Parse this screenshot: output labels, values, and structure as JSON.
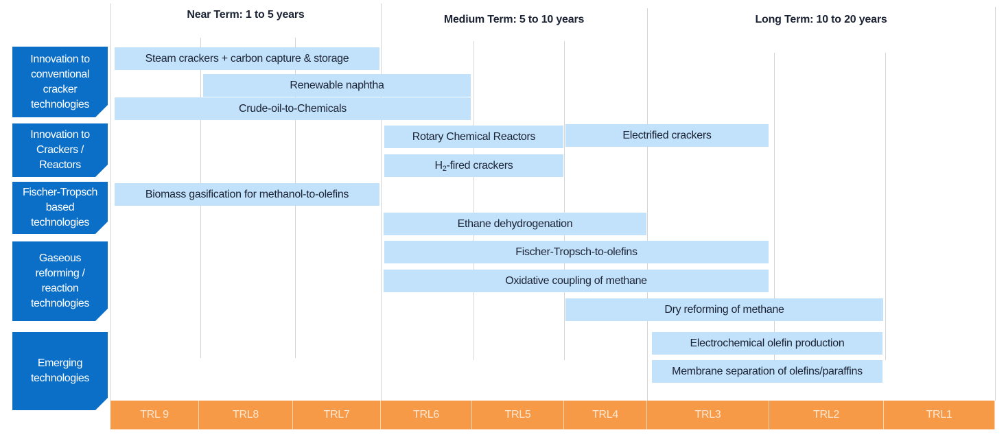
{
  "terms": [
    {
      "label": "Near Term: 1 to 5 years",
      "trl_from": 9,
      "trl_to": 7
    },
    {
      "label": "Medium Term: 5 to 10 years",
      "trl_from": 6,
      "trl_to": 4
    },
    {
      "label": "Long Term: 10 to 20 years",
      "trl_from": 3,
      "trl_to": 1
    }
  ],
  "categories": [
    {
      "label": "Innovation to\nconventional\ncracker\ntechnologies"
    },
    {
      "label": "Innovation to\nCrackers /\nReactors"
    },
    {
      "label": "Fischer-Tropsch\nbased\ntechnologies"
    },
    {
      "label": "Gaseous\nreforming /\nreaction\ntechnologies"
    },
    {
      "label": "Emerging\ntechnologies"
    }
  ],
  "trl_scale": [
    "TRL 9",
    "TRL8",
    "TRL7",
    "TRL6",
    "TRL5",
    "TRL4",
    "TRL3",
    "TRL2",
    "TRL1"
  ],
  "technologies": [
    {
      "label": "Steam crackers + carbon capture & storage",
      "category": 0,
      "trl_start": 9,
      "trl_end": 7
    },
    {
      "label": "Renewable naphtha",
      "category": 0,
      "trl_start": 8,
      "trl_end": 6
    },
    {
      "label": "Crude-oil-to-Chemicals",
      "category": 0,
      "trl_start": 9,
      "trl_end": 6
    },
    {
      "label": "Rotary Chemical Reactors",
      "category": 1,
      "trl_start": 6,
      "trl_end": 5
    },
    {
      "label": "Electrified crackers",
      "category": 1,
      "trl_start": 4,
      "trl_end": 3
    },
    {
      "label_main": "H",
      "label_sub": "2",
      "label_rest": "-fired crackers",
      "category": 1,
      "trl_start": 6,
      "trl_end": 5
    },
    {
      "label": "Biomass gasification for methanol-to-olefins",
      "category": 2,
      "trl_start": 9,
      "trl_end": 7
    },
    {
      "label": "Ethane dehydrogenation",
      "category": 2,
      "trl_start": 6,
      "trl_end": 4
    },
    {
      "label": "Fischer-Tropsch-to-olefins",
      "category": 3,
      "trl_start": 6,
      "trl_end": 3
    },
    {
      "label": "Oxidative coupling of methane",
      "category": 3,
      "trl_start": 6,
      "trl_end": 3
    },
    {
      "label": "Dry reforming of methane",
      "category": 3,
      "trl_start": 4,
      "trl_end": 2
    },
    {
      "label": "Electrochemical olefin production",
      "category": 4,
      "trl_start": 3,
      "trl_end": 2
    },
    {
      "label": "Membrane separation of olefins/paraffins",
      "category": 4,
      "trl_start": 3,
      "trl_end": 2
    }
  ],
  "colors": {
    "category_fill": "#0b6fc8",
    "bar_fill": "#c2e1fa",
    "trl_fill": "#f79a48"
  }
}
